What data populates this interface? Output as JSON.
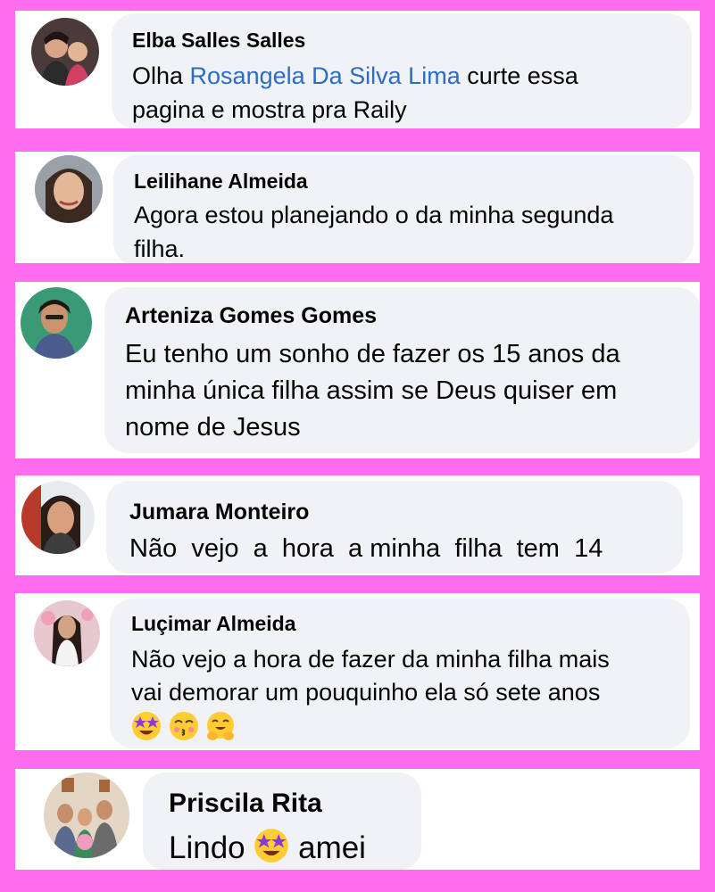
{
  "comments": [
    {
      "author": "Elba Salles Salles",
      "line1_pre": "Olha ",
      "mention": "Rosangela Da Silva Lima",
      "line1_post": " curte essa",
      "line2": "pagina e mostra pra Raily"
    },
    {
      "author": "Leilihane Almeida",
      "line1": "Agora estou planejando o da minha segunda",
      "line2": "filha."
    },
    {
      "author": "Arteniza Gomes Gomes",
      "line1": "Eu tenho um sonho de fazer os 15 anos da",
      "line2": "minha única filha assim se Deus quiser em",
      "line3": "nome de Jesus"
    },
    {
      "author": "Jumara Monteiro",
      "line1": "Não  vejo  a  hora  a minha  filha  tem  14"
    },
    {
      "author": "Luçimar Almeida",
      "line1": "Não vejo a hora de fazer da minha filha mais",
      "line2": "vai demorar um pouquinho ela só sete anos",
      "emojis": [
        "star-struck-emoji",
        "kissing-emoji",
        "hugging-emoji"
      ]
    },
    {
      "author": "Priscila Rita",
      "text_pre": "Lindo ",
      "emoji": "star-struck-emoji",
      "text_post": " amei"
    }
  ],
  "colors": {
    "background": "#ff6cef",
    "bubble": "#f0f2f5",
    "mention": "#2b6cc4",
    "text": "#050505"
  }
}
